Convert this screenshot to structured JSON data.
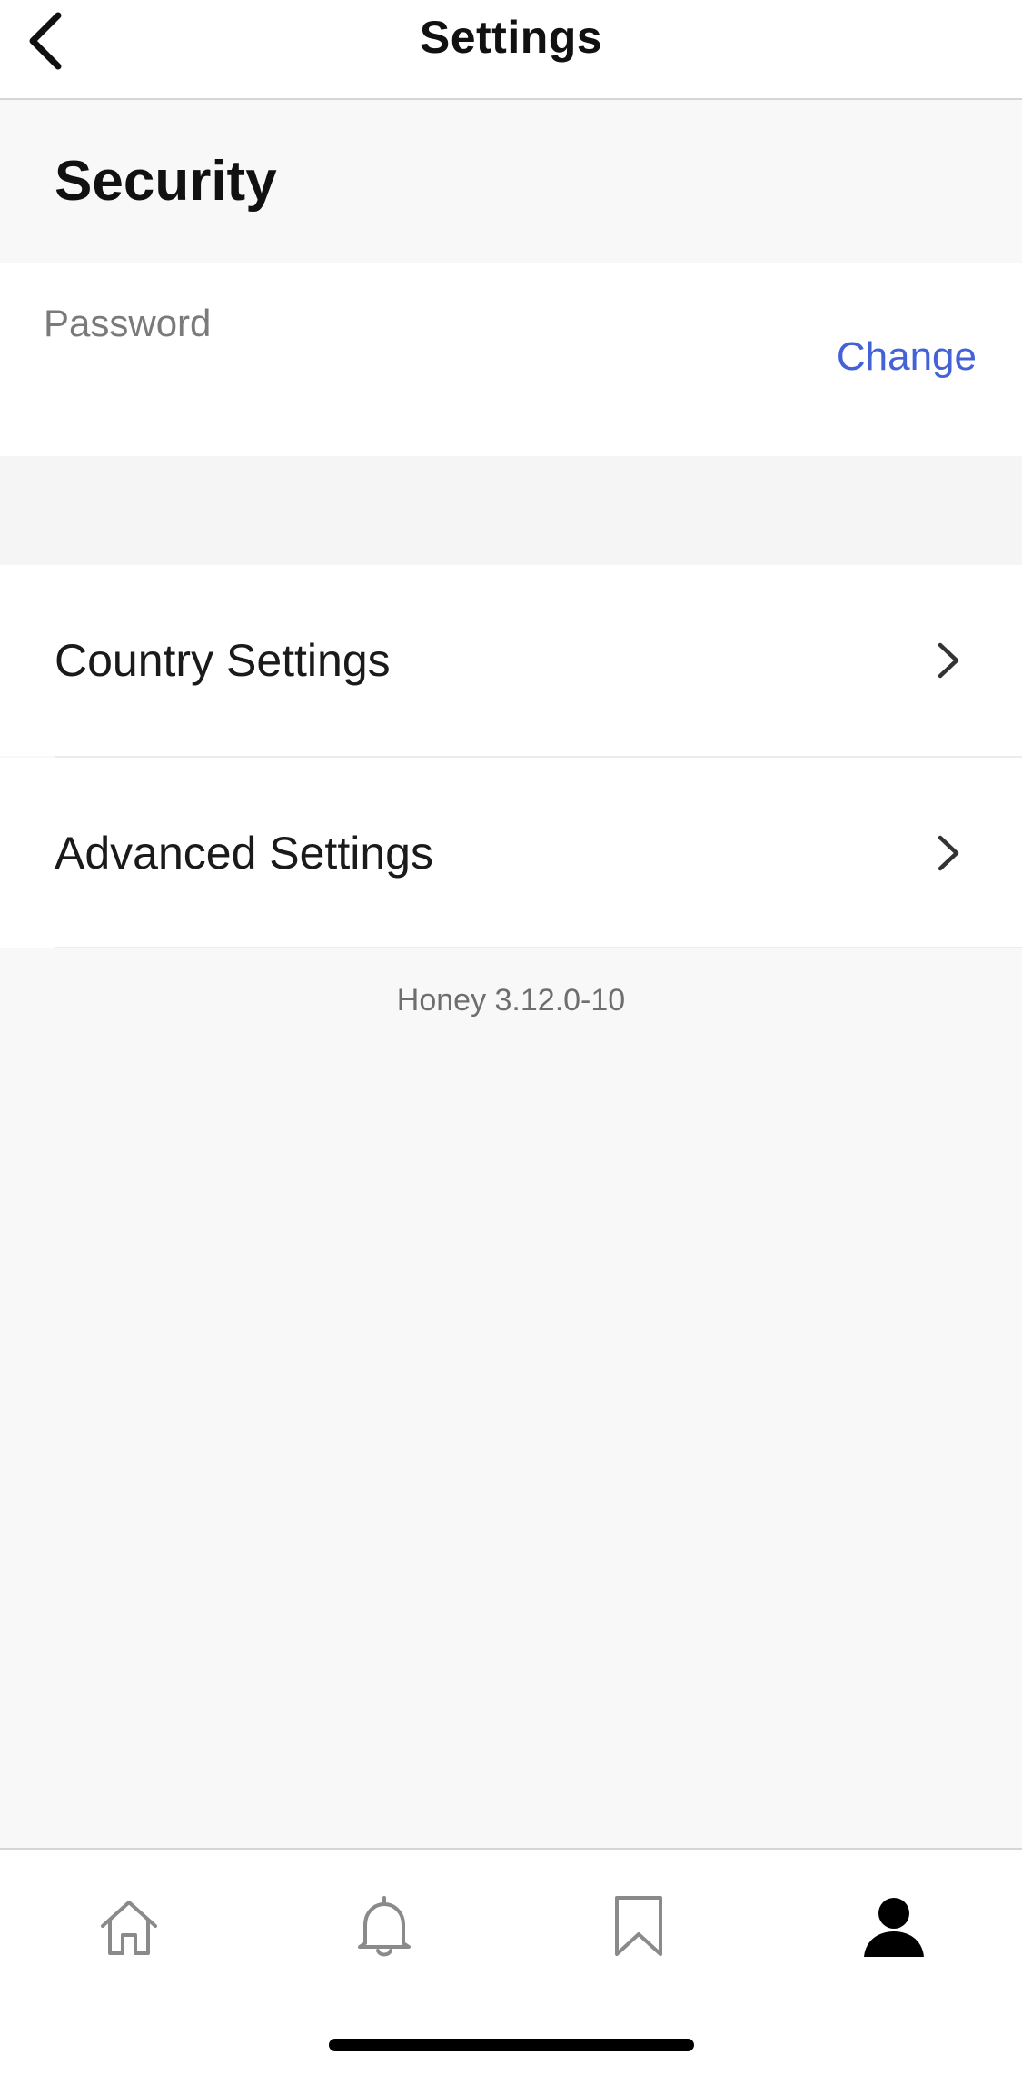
{
  "header": {
    "title": "Settings",
    "back_icon": "chevron-left-icon"
  },
  "security": {
    "title": "Security",
    "password_label": "Password",
    "change_label": "Change",
    "accent_color": "#4362d8"
  },
  "menu": {
    "items": [
      {
        "label": "Country Settings",
        "icon": "chevron-right-icon"
      },
      {
        "label": "Advanced Settings",
        "icon": "chevron-right-icon"
      }
    ]
  },
  "footer": {
    "version": "Honey 3.12.0-10"
  },
  "tab_bar": {
    "tabs": [
      {
        "icon": "home-icon",
        "active": false
      },
      {
        "icon": "bell-icon",
        "active": false
      },
      {
        "icon": "bookmark-icon",
        "active": false
      },
      {
        "icon": "profile-icon",
        "active": true
      }
    ]
  }
}
